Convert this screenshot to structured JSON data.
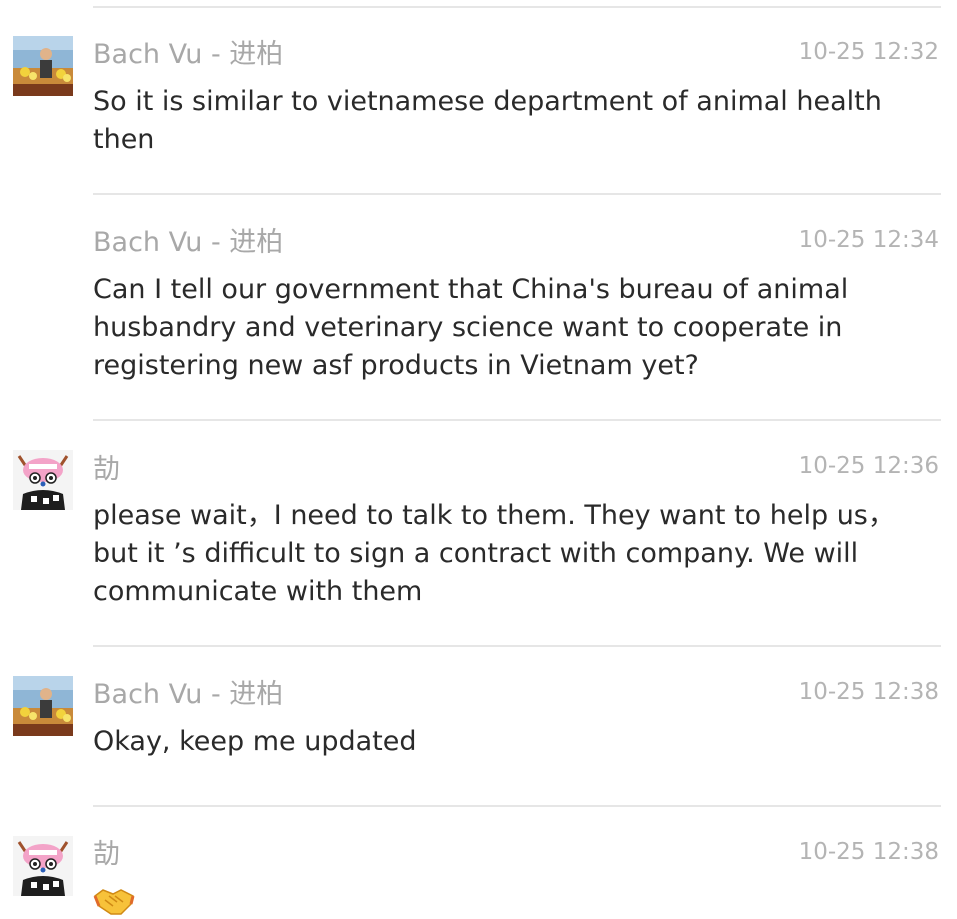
{
  "messages": [
    {
      "sender": "Bach Vu - 进柏",
      "time": "10-25 12:32",
      "text": "So it is similar to vietnamese department of animal health then",
      "avatar": "photo-avatar"
    },
    {
      "sender": "Bach Vu - 进柏",
      "time": "10-25 12:34",
      "text": "Can I tell our government that China's bureau of animal husbandry and veterinary science want to cooperate in registering new asf products in Vietnam yet?"
    },
    {
      "sender": "劼",
      "time": "10-25 12:36",
      "text": "please wait，I need to talk to them. They want to help us，but it ’s difficult to sign a contract with company. We will communicate with them",
      "avatar": "cartoon-avatar"
    },
    {
      "sender": "Bach Vu - 进柏",
      "time": "10-25 12:38",
      "text": "Okay, keep me updated",
      "avatar": "photo-avatar"
    },
    {
      "sender": "劼",
      "time": "10-25 12:38",
      "emoji": "handshake-emoji",
      "avatar": "cartoon-avatar"
    }
  ],
  "colors": {
    "sender": "#a8a8a8",
    "time": "#b4b4b4",
    "text": "#2a2a2a",
    "divider": "#e6e6e6"
  }
}
